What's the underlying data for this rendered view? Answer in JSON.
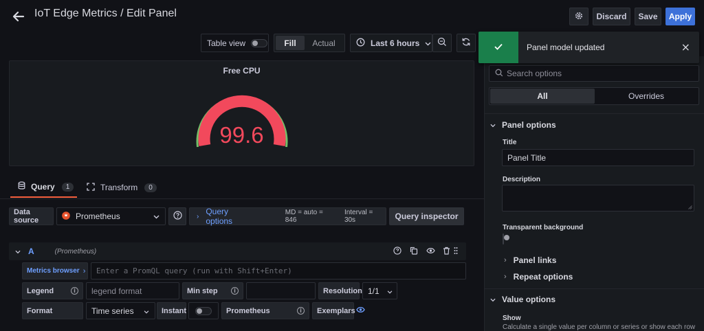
{
  "header": {
    "title": "IoT Edge Metrics / Edit Panel",
    "discard_label": "Discard",
    "save_label": "Save",
    "apply_label": "Apply"
  },
  "toolbar": {
    "table_view_label": "Table view",
    "fill_label": "Fill",
    "actual_label": "Actual",
    "time_range": "Last 6 hours"
  },
  "panel": {
    "title": "Free CPU",
    "value": "99.6",
    "gauge_fill_percent": 99.6,
    "colors": {
      "threshold_red": "#f2495c",
      "threshold_green": "#73bf69"
    }
  },
  "tabs": {
    "query_label": "Query",
    "query_count": "1",
    "transform_label": "Transform",
    "transform_count": "0"
  },
  "datasource": {
    "label": "Data source",
    "selected": "Prometheus",
    "query_options_label": "Query options",
    "md": "MD = auto = 846",
    "interval": "Interval = 30s",
    "inspector_label": "Query inspector"
  },
  "query_row": {
    "ref_id": "A",
    "source": "(Prometheus)",
    "metrics_browser_label": "Metrics browser",
    "query_placeholder": "Enter a PromQL query (run with Shift+Enter)",
    "legend_label": "Legend",
    "legend_placeholder": "legend format",
    "min_step_label": "Min step",
    "resolution_label": "Resolution",
    "resolution_value": "1/1",
    "format_label": "Format",
    "format_value": "Time series",
    "instant_label": "Instant",
    "prometheus_label": "Prometheus",
    "exemplars_label": "Exemplars"
  },
  "toast": {
    "message": "Panel model updated",
    "close": "×"
  },
  "options_pane": {
    "search_placeholder": "Search options",
    "tab_all": "All",
    "tab_overrides": "Overrides",
    "panel_options_label": "Panel options",
    "title_label": "Title",
    "title_value": "Panel Title",
    "description_label": "Description",
    "transparent_label": "Transparent background",
    "panel_links_label": "Panel links",
    "repeat_options_label": "Repeat options",
    "value_options_label": "Value options",
    "show_label": "Show",
    "show_description": "Calculate a single value per column or series or show each row"
  }
}
